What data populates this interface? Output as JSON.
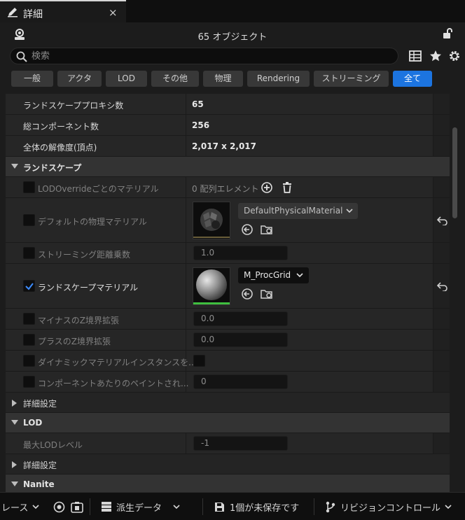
{
  "tab": {
    "title": "詳細",
    "close": "×"
  },
  "header": {
    "object_count": "65 オブジェクト"
  },
  "search": {
    "placeholder": "検索"
  },
  "filters": [
    "一般",
    "アクタ",
    "LOD",
    "その他",
    "物理",
    "Rendering",
    "ストリーミング",
    "全て"
  ],
  "filter_active": "全て",
  "info": [
    {
      "label": "ランドスケーププロキシ数",
      "value": "65"
    },
    {
      "label": "総コンポーネント数",
      "value": "256"
    },
    {
      "label": "全体の解像度(頂点)",
      "value": "2,017 x 2,017"
    }
  ],
  "landscape": {
    "title": "ランドスケープ",
    "lod_override": {
      "label": "LODOverrideごとのマテリアル",
      "value": "0 配列エレメント"
    },
    "default_phys": {
      "label": "デフォルトの物理マテリアル",
      "value": "DefaultPhysicalMaterial"
    },
    "streaming": {
      "label": "ストリーミング距離乗数",
      "value": "1.0"
    },
    "material": {
      "label": "ランドスケープマテリアル",
      "value": "M_ProcGrid"
    },
    "neg_z": {
      "label": "マイナスのZ境界拡張",
      "value": "0.0"
    },
    "pos_z": {
      "label": "プラスのZ境界拡張",
      "value": "0.0"
    },
    "dyn_mat": {
      "label": "ダイナミックマテリアルインスタンスを..."
    },
    "paint": {
      "label": "コンポーネントあたりのペイントされ...",
      "value": "0"
    },
    "advanced": "詳細設定"
  },
  "lod": {
    "title": "LOD",
    "max_lod": {
      "label": "最大LODレベル",
      "value": "-1"
    },
    "advanced": "詳細設定"
  },
  "nanite": {
    "title": "Nanite"
  },
  "statusbar": {
    "trace": "レース",
    "derived": "派生データ",
    "unsaved": "1個が未保存です",
    "revision": "リビジョンコントロール"
  },
  "colors": {
    "accent": "#1c74e0",
    "green": "#3fbf3f"
  }
}
